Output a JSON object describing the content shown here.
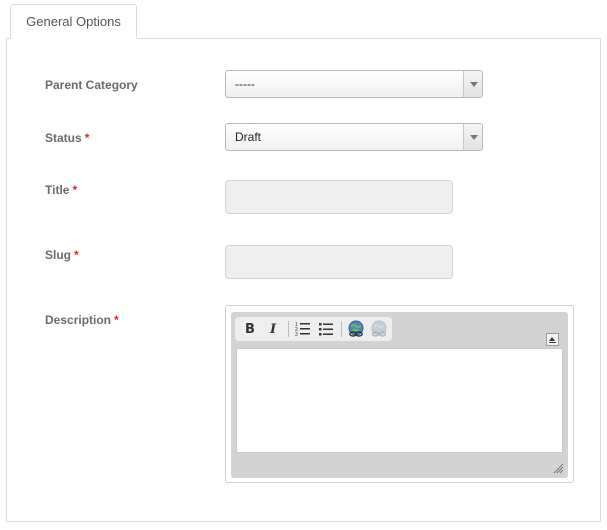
{
  "tabs": [
    {
      "label": "General Options",
      "active": true
    }
  ],
  "form": {
    "required_mark": "*",
    "parent_category": {
      "label": "Parent Category",
      "value": "-----"
    },
    "status": {
      "label": "Status",
      "value": "Draft"
    },
    "title": {
      "label": "Title",
      "value": ""
    },
    "slug": {
      "label": "Slug",
      "value": ""
    },
    "description": {
      "label": "Description",
      "value": ""
    }
  },
  "editor": {
    "toolbar": {
      "bold_label": "B",
      "italic_label": "I",
      "icons": [
        "bold-icon",
        "italic-icon",
        "ordered-list-icon",
        "unordered-list-icon",
        "link-icon",
        "unlink-icon",
        "collapse-toolbar-icon",
        "resize-handle-icon"
      ]
    }
  },
  "colors": {
    "label_text": "#6b6b6b",
    "required": "#d9262c",
    "input_bg": "#efefef",
    "border": "#dddddd"
  }
}
